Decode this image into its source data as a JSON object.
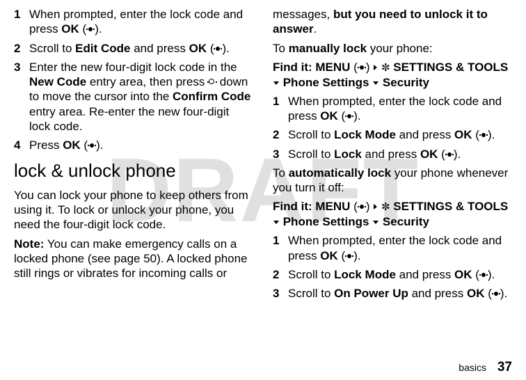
{
  "watermark": "DRAFT",
  "left": {
    "s1": {
      "n": "1",
      "a": "When prompted, enter the lock code and press ",
      "ok": "OK",
      "p1": " (",
      "p2": ")."
    },
    "s2": {
      "n": "2",
      "a": "Scroll to ",
      "ec": "Edit Code",
      "b": " and press ",
      "ok": "OK",
      "p1": " (",
      "p2": ")."
    },
    "s3": {
      "n": "3",
      "a": "Enter the new four-digit lock code in the ",
      "nc": "New Code",
      "b": " entry area, then press ",
      "c": " down to move the cursor into the ",
      "cc": "Confirm Code",
      "d": " entry area. Re-enter the new four-digit lock code."
    },
    "s4": {
      "n": "4",
      "a": "Press ",
      "ok": "OK",
      "p1": " (",
      "p2": ")."
    },
    "heading": "lock & unlock phone",
    "p1": "You can lock your phone to keep others from using it. To lock or unlock your phone, you need the four-digit lock code.",
    "p2a": "Note:",
    "p2b": " You can make emergency calls on a locked phone (see page 50). A locked phone still rings or vibrates for incoming calls or "
  },
  "right": {
    "cont_a": "messages, ",
    "cont_b": "but you need to unlock it to answer",
    "cont_c": ".",
    "man_a": "To ",
    "man_b": "manually lock",
    "man_c": " your phone:",
    "find_label": "Find it: ",
    "menu": "MENU",
    "p1": " (",
    "p2": ") ",
    "settings": " SETTINGS & TOOLS",
    "phone": " Phone Settings ",
    "security": " Security",
    "s1": {
      "n": "1",
      "a": "When prompted, enter the lock code and press ",
      "ok": "OK",
      "p1": " (",
      "p2": ")."
    },
    "s2": {
      "n": "2",
      "a": "Scroll to ",
      "lm": "Lock Mode",
      "b": " and press ",
      "ok": "OK",
      "p1": " (",
      "p2": ")."
    },
    "s3": {
      "n": "3",
      "a": "Scroll to ",
      "lk": "Lock",
      "b": " and press ",
      "ok": "OK",
      "p1": " (",
      "p2": ")."
    },
    "auto_a": "To ",
    "auto_b": "automatically lock",
    "auto_c": " your phone whenever you turn it off:",
    "b1": {
      "n": "1",
      "a": "When prompted, enter the lock code and press ",
      "ok": "OK",
      "p1": " (",
      "p2": ")."
    },
    "b2": {
      "n": "2",
      "a": "Scroll to ",
      "lm": "Lock Mode",
      "b": " and press ",
      "ok": "OK",
      "p1": " (",
      "p2": ")."
    },
    "b3": {
      "n": "3",
      "a": "Scroll to ",
      "opu": "On Power Up",
      "b": " and press ",
      "ok": "OK",
      "p1": " (",
      "p2": ")."
    }
  },
  "footer": {
    "section": "basics",
    "page": "37"
  }
}
